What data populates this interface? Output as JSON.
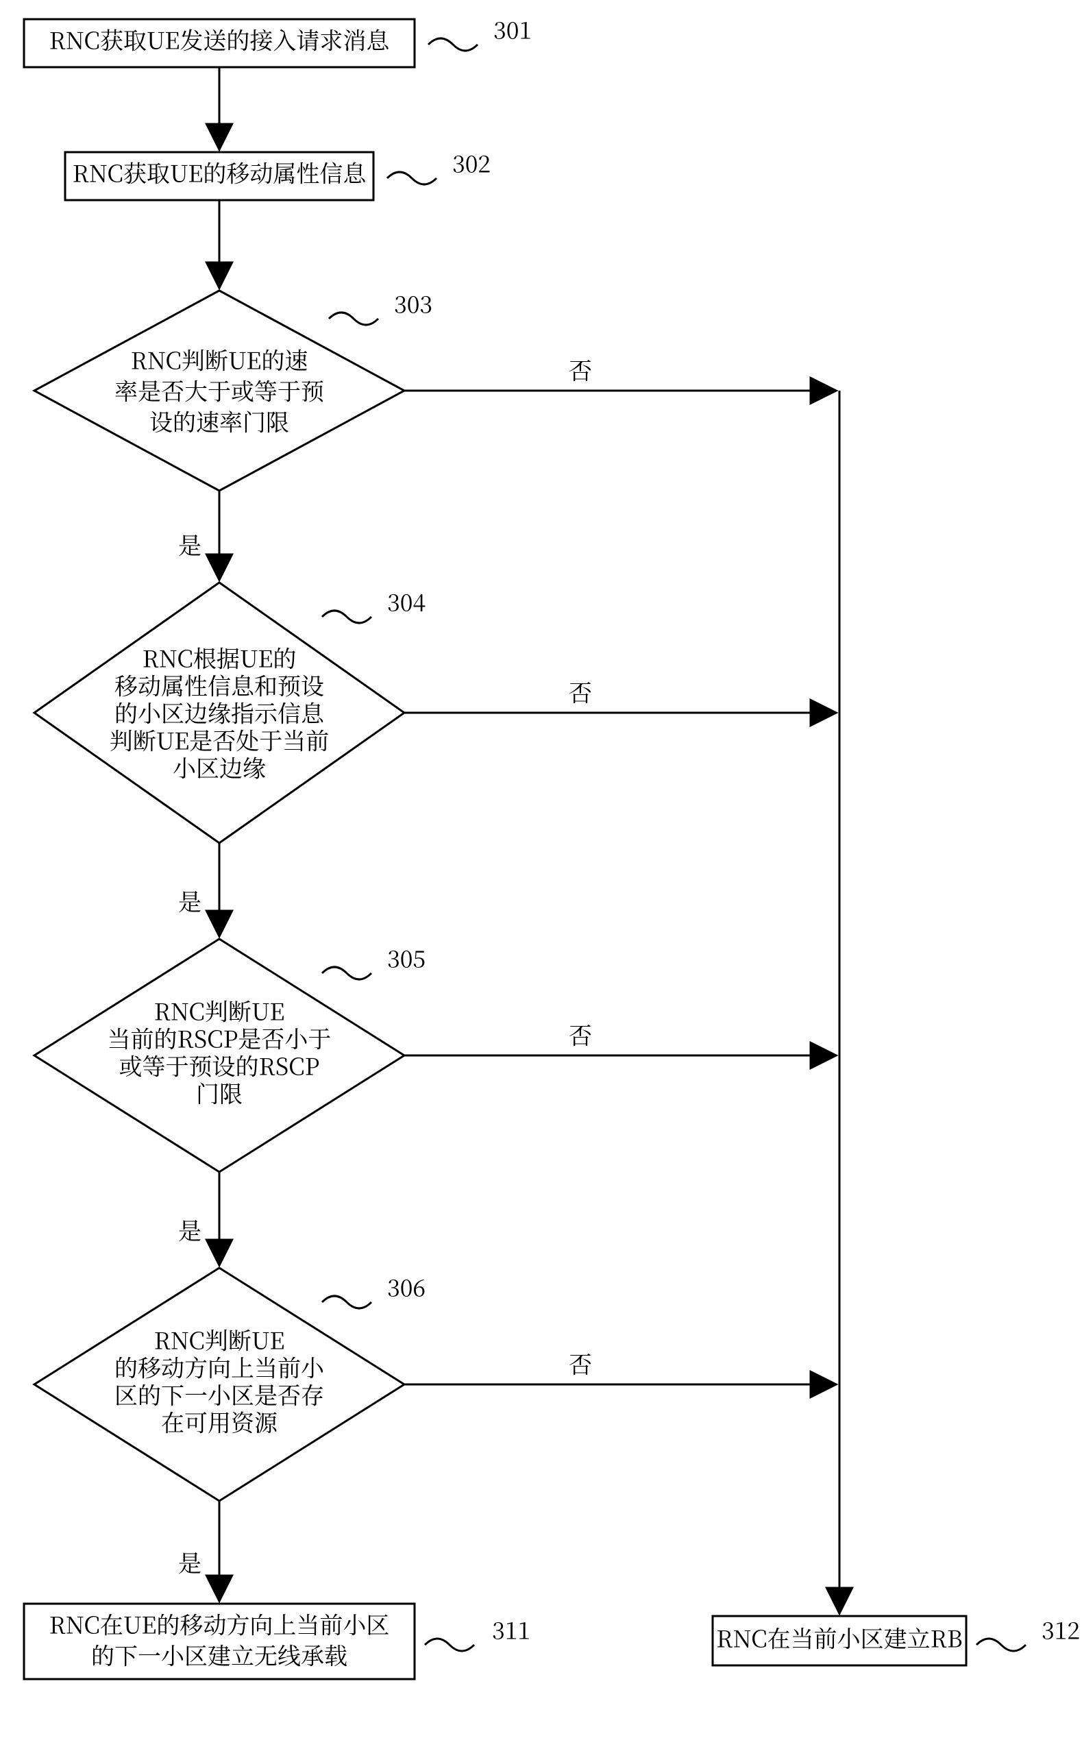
{
  "steps": {
    "s301": {
      "num": "301",
      "text": "RNC获取UE发送的接入请求消息"
    },
    "s302": {
      "num": "302",
      "text": "RNC获取UE的移动属性信息"
    },
    "s303": {
      "num": "303",
      "l1": "RNC判断UE的速",
      "l2": "率是否大于或等于预",
      "l3": "设的速率门限"
    },
    "s304": {
      "num": "304",
      "l1": "RNC根据UE的",
      "l2": "移动属性信息和预设",
      "l3": "的小区边缘指示信息",
      "l4": "判断UE是否处于当前",
      "l5": "小区边缘"
    },
    "s305": {
      "num": "305",
      "l1": "RNC判断UE",
      "l2": "当前的RSCP是否小于",
      "l3": "或等于预设的RSCP",
      "l4": "门限"
    },
    "s306": {
      "num": "306",
      "l1": "RNC判断UE",
      "l2": "的移动方向上当前小",
      "l3": "区的下一小区是否存",
      "l4": "在可用资源"
    },
    "s311": {
      "num": "311",
      "l1": "RNC在UE的移动方向上当前小区",
      "l2": "的下一小区建立无线承载"
    },
    "s312": {
      "num": "312",
      "text": "RNC在当前小区建立RB"
    }
  },
  "labels": {
    "yes": "是",
    "no": "否"
  }
}
